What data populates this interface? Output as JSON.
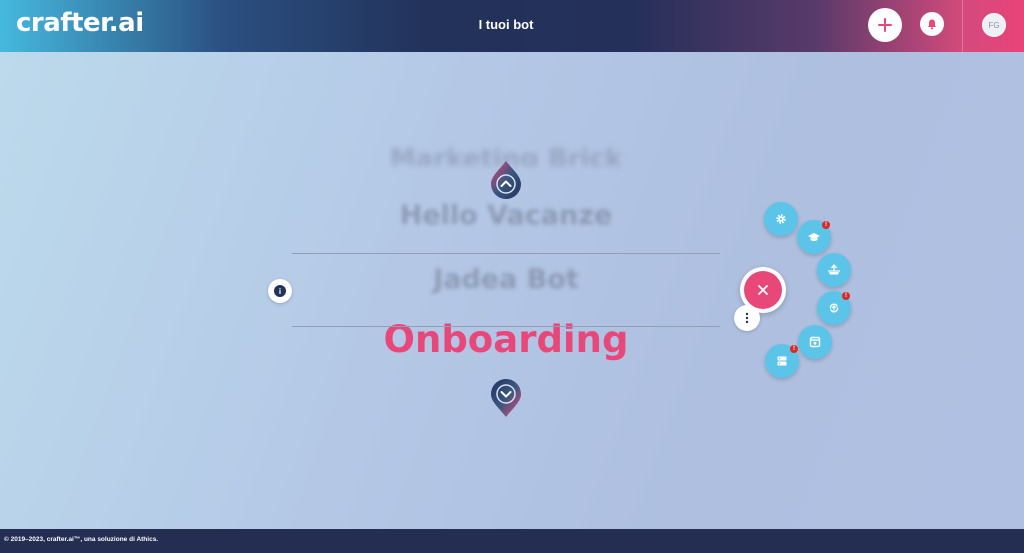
{
  "header": {
    "logo_text": "crafter.ai",
    "title": "I tuoi bot",
    "add_button_icon": "plus-icon",
    "notifications_icon": "bell-icon",
    "avatar_initials": "FG"
  },
  "bot_carousel": {
    "items": [
      "Marketing Brick",
      "Hello Vacanze",
      "Jadea Bot",
      "Onboarding"
    ],
    "selected": "Onboarding",
    "prev_icon": "chevron-up-icon",
    "next_icon": "chevron-down-icon",
    "info_icon": "info-icon"
  },
  "bot_menu": {
    "close_icon": "close-icon",
    "more_icon": "more-vertical-icon",
    "actions": [
      {
        "icon": "gear-icon",
        "badge": false
      },
      {
        "icon": "graduation-cap-icon",
        "badge": true
      },
      {
        "icon": "deploy-icon",
        "badge": false
      },
      {
        "icon": "sync-icon",
        "badge": true
      },
      {
        "icon": "window-icon",
        "badge": false
      },
      {
        "icon": "server-icon",
        "badge": true
      }
    ],
    "badge_text": "!"
  },
  "colors": {
    "accent": "#e8477a",
    "action_blue": "#5cc4e8",
    "header_dark": "#22325a",
    "footer": "#232e52"
  },
  "footer": {
    "copyright": "© 2019–2023, crafter.ai™, una soluzione di Athics."
  }
}
